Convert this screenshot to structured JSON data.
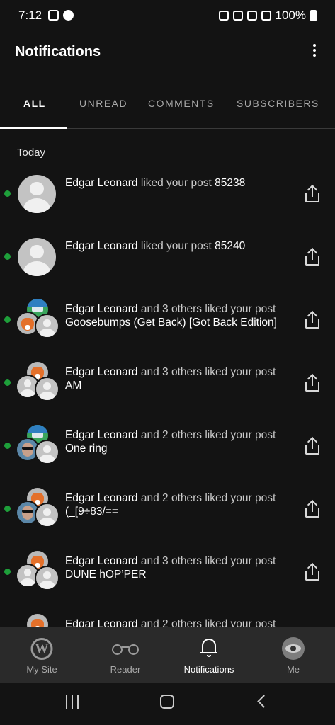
{
  "status_bar": {
    "time": "7:12",
    "battery": "100%"
  },
  "header": {
    "title": "Notifications"
  },
  "tabs": [
    {
      "label": "ALL",
      "active": true
    },
    {
      "label": "UNREAD",
      "active": false
    },
    {
      "label": "COMMENTS",
      "active": false
    },
    {
      "label": "SUBSCRIBERS",
      "active": false
    }
  ],
  "section": {
    "heading": "Today"
  },
  "notifications": [
    {
      "actor": "Edgar Leonard",
      "action": " liked your post ",
      "post": "85238",
      "unread": true
    },
    {
      "actor": "Edgar Leonard",
      "action": " liked your post ",
      "post": "85240",
      "unread": true
    },
    {
      "actor": "Edgar Leonard",
      "action": " and 3 others liked your post ",
      "post": "Goosebumps (Get Back) [Got Back Edition]",
      "unread": true
    },
    {
      "actor": "Edgar Leonard",
      "action": " and 3 others liked your post ",
      "post": "AM",
      "unread": true
    },
    {
      "actor": "Edgar Leonard",
      "action": " and 2 others liked your post ",
      "post": "One ring",
      "unread": true
    },
    {
      "actor": "Edgar Leonard",
      "action": " and 2 others liked your post ",
      "post": "(_[9÷83/==",
      "unread": true
    },
    {
      "actor": "Edgar Leonard",
      "action": " and 3 others liked your post ",
      "post": "DUNE hOP’PER",
      "unread": true
    },
    {
      "actor": "Edgar Leonard",
      "action": " and 2 others liked your post ",
      "post": "",
      "unread": true
    }
  ],
  "bottom_nav": [
    {
      "label": "My Site",
      "icon": "wordpress-icon",
      "active": false
    },
    {
      "label": "Reader",
      "icon": "glasses-icon",
      "active": false
    },
    {
      "label": "Notifications",
      "icon": "bell-icon",
      "active": true
    },
    {
      "label": "Me",
      "icon": "avatar",
      "active": false
    }
  ],
  "colors": {
    "background": "#131313",
    "unread_dot": "#1e9f3a",
    "nav_background": "#2a2a2a"
  }
}
